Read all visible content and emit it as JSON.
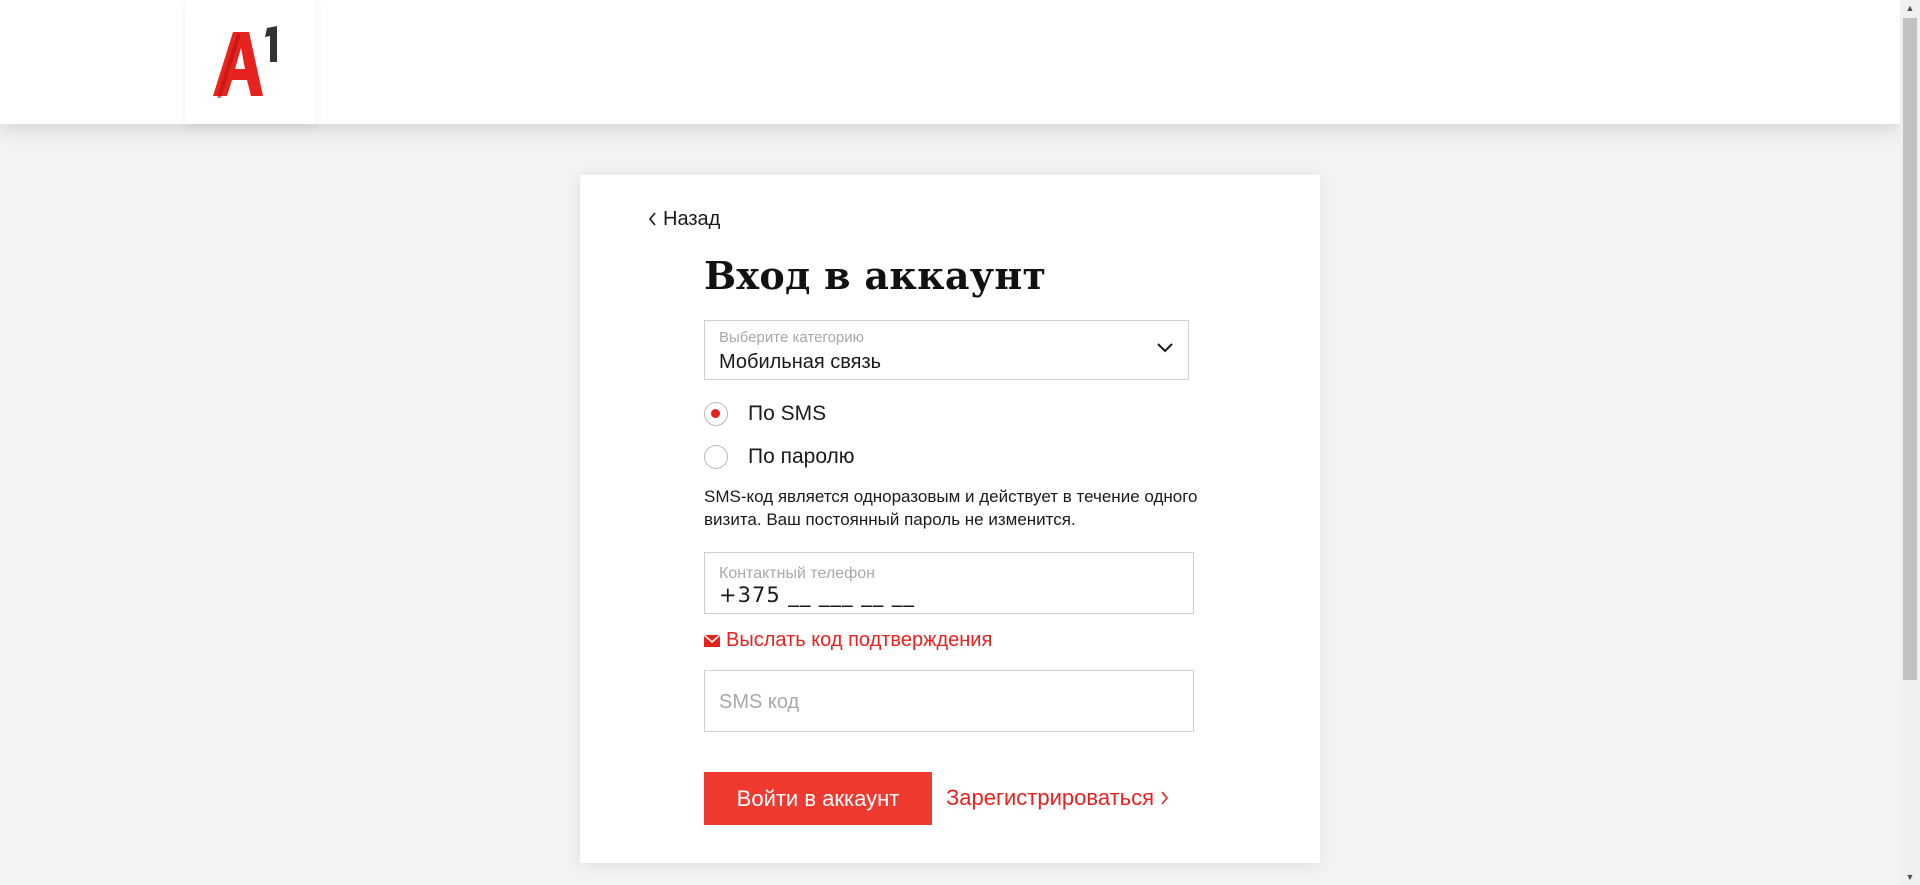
{
  "header": {
    "logo_text": "A1"
  },
  "login": {
    "back_label": "Назад",
    "title": "Вход в аккаунт",
    "category": {
      "label": "Выберите категорию",
      "value": "Мобильная связь"
    },
    "methods": [
      {
        "label": "По SMS",
        "selected": true
      },
      {
        "label": "По паролю",
        "selected": false
      }
    ],
    "info_text": "SMS-код является одноразовым и действует в течение одного визита. Ваш постоянный пароль не изменится.",
    "phone": {
      "label": "Контактный телефон",
      "value": "+375 __ ___ __ __"
    },
    "send_code_label": "Выслать код подтверждения",
    "sms_code": {
      "placeholder": "SMS код"
    },
    "submit_label": "Войти в аккаунт",
    "register_label": "Зарегистрироваться"
  },
  "colors": {
    "accent": "#e6231e",
    "button": "#f03a30",
    "background": "#f2f3f3"
  },
  "icons": [
    "a1-logo",
    "chevron-left-icon",
    "chevron-down-icon",
    "envelope-icon",
    "chevron-right-icon"
  ]
}
